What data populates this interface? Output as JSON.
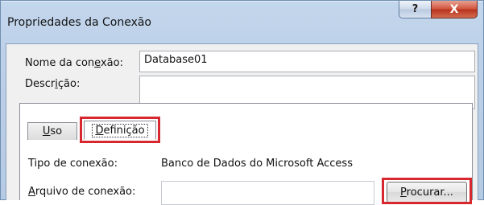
{
  "window": {
    "title": "Propriedades da Conexão",
    "help_button": "?",
    "close_button": "X"
  },
  "form": {
    "name_label_before": "Nome da con",
    "name_label_accel": "e",
    "name_label_after": "xão:",
    "name_value": "Database01",
    "description_label_before": "Descr",
    "description_label_accel": "i",
    "description_label_after": "ção:",
    "description_value": ""
  },
  "tabs": [
    {
      "accel": "U",
      "rest": "so",
      "active": false
    },
    {
      "accel": "D",
      "rest": "efinição",
      "active": true
    }
  ],
  "definition": {
    "type_label": "Tipo de conexão:",
    "type_value": "Banco de Dados do Microsoft Access",
    "file_label_accel": "A",
    "file_label_rest": "rquivo de conexão:",
    "file_value": "",
    "browse_accel": "P",
    "browse_rest": "rocurar..."
  },
  "colors": {
    "highlight": "#d8282f",
    "title_bar": "#bcd0e8",
    "close_button": "#c7432c"
  }
}
